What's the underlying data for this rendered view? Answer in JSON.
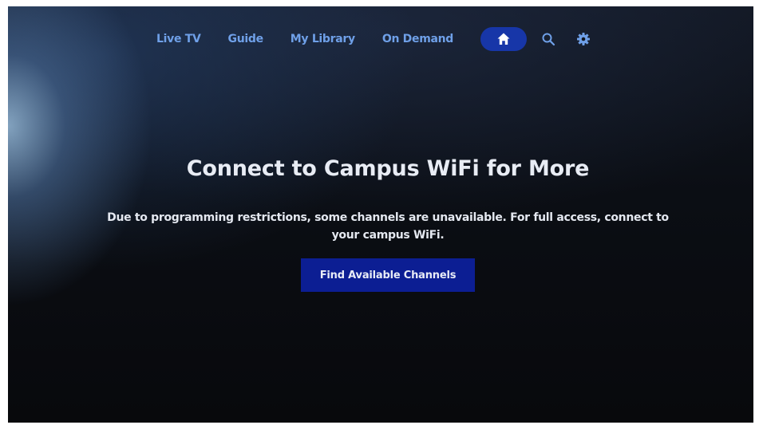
{
  "nav": {
    "items": [
      {
        "label": "Live TV"
      },
      {
        "label": "Guide"
      },
      {
        "label": "My Library"
      },
      {
        "label": "On Demand"
      }
    ],
    "icons": [
      "home-icon",
      "search-icon",
      "gear-icon"
    ],
    "active": "home"
  },
  "main": {
    "headline": "Connect to Campus WiFi for More",
    "body": "Due to programming restrictions, some channels are unavailable. For full access, connect to your campus WiFi.",
    "cta_label": "Find Available Channels"
  },
  "colors": {
    "nav_text": "#6fa0e8",
    "active_pill": "#1736a8",
    "cta_background": "#0c1e93",
    "text": "#e8ecf4"
  }
}
